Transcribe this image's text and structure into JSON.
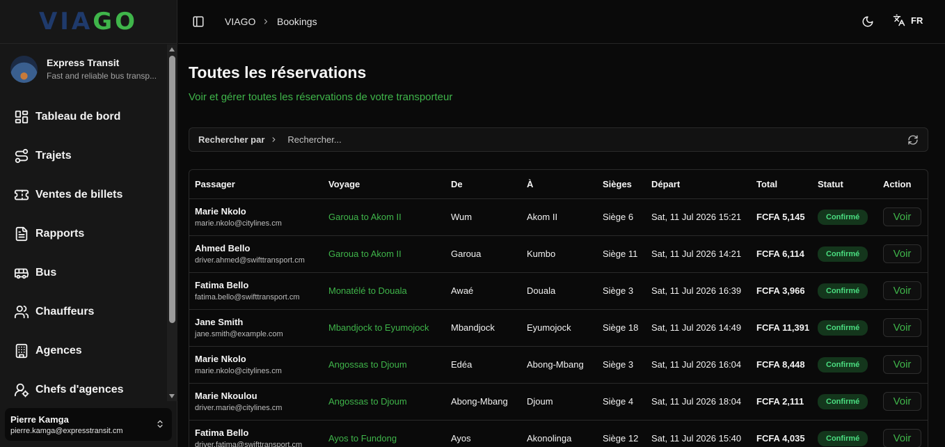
{
  "brand": {
    "logo_left": "VIA",
    "logo_right": "GO"
  },
  "company": {
    "name": "Express Transit",
    "subtitle": "Fast and reliable bus transp..."
  },
  "sidebar": {
    "items": [
      {
        "label": "Tableau de bord",
        "icon": "dashboard-icon"
      },
      {
        "label": "Trajets",
        "icon": "route-icon"
      },
      {
        "label": "Ventes de billets",
        "icon": "ticket-icon"
      },
      {
        "label": "Rapports",
        "icon": "report-icon"
      },
      {
        "label": "Bus",
        "icon": "bus-icon"
      },
      {
        "label": "Chauffeurs",
        "icon": "users-icon"
      },
      {
        "label": "Agences",
        "icon": "building-icon"
      },
      {
        "label": "Chefs d'agences",
        "icon": "user-settings-icon"
      }
    ]
  },
  "user": {
    "name": "Pierre Kamga",
    "email": "pierre.kamga@expresstransit.cm"
  },
  "topbar": {
    "crumb_root": "VIAGO",
    "crumb_current": "Bookings",
    "lang": "FR"
  },
  "page": {
    "title": "Toutes les réservations",
    "subtitle": "Voir et gérer toutes les réservations de votre transporteur"
  },
  "search": {
    "by_label": "Rechercher par",
    "placeholder": "Rechercher..."
  },
  "table": {
    "headers": [
      "Passager",
      "Voyage",
      "De",
      "À",
      "Sièges",
      "Départ",
      "Total",
      "Statut",
      "Action"
    ],
    "rows": [
      {
        "name": "Marie Nkolo",
        "email": "marie.nkolo@citylines.cm",
        "trip": "Garoua to Akom II",
        "from": "Wum",
        "to": "Akom II",
        "seat": "Siège 6",
        "departure": "Sat, 11 Jul 2026 15:21",
        "total": "FCFA 5,145",
        "status": "Confirmé",
        "action": "Voir"
      },
      {
        "name": "Ahmed Bello",
        "email": "driver.ahmed@swifttransport.cm",
        "trip": "Garoua to Akom II",
        "from": "Garoua",
        "to": "Kumbo",
        "seat": "Siège 11",
        "departure": "Sat, 11 Jul 2026 14:21",
        "total": "FCFA 6,114",
        "status": "Confirmé",
        "action": "Voir"
      },
      {
        "name": "Fatima Bello",
        "email": "fatima.bello@swifttransport.cm",
        "trip": "Monatélé to Douala",
        "from": "Awaé",
        "to": "Douala",
        "seat": "Siège 3",
        "departure": "Sat, 11 Jul 2026 16:39",
        "total": "FCFA 3,966",
        "status": "Confirmé",
        "action": "Voir"
      },
      {
        "name": "Jane Smith",
        "email": "jane.smith@example.com",
        "trip": "Mbandjock to Eyumojock",
        "from": "Mbandjock",
        "to": "Eyumojock",
        "seat": "Siège 18",
        "departure": "Sat, 11 Jul 2026 14:49",
        "total": "FCFA 11,391",
        "status": "Confirmé",
        "action": "Voir"
      },
      {
        "name": "Marie Nkolo",
        "email": "marie.nkolo@citylines.cm",
        "trip": "Angossas to Djoum",
        "from": "Edéa",
        "to": "Abong-Mbang",
        "seat": "Siège 3",
        "departure": "Sat, 11 Jul 2026 16:04",
        "total": "FCFA 8,448",
        "status": "Confirmé",
        "action": "Voir"
      },
      {
        "name": "Marie Nkoulou",
        "email": "driver.marie@citylines.cm",
        "trip": "Angossas to Djoum",
        "from": "Abong-Mbang",
        "to": "Djoum",
        "seat": "Siège 4",
        "departure": "Sat, 11 Jul 2026 18:04",
        "total": "FCFA 2,111",
        "status": "Confirmé",
        "action": "Voir"
      },
      {
        "name": "Fatima Bello",
        "email": "driver.fatima@swifttransport.cm",
        "trip": "Ayos to Fundong",
        "from": "Ayos",
        "to": "Akonolinga",
        "seat": "Siège 12",
        "departure": "Sat, 11 Jul 2026 15:40",
        "total": "FCFA 4,035",
        "status": "Confirmé",
        "action": "Voir"
      }
    ]
  },
  "colors": {
    "accent": "#3fb54a",
    "logo_dark": "#1f3a6b",
    "badge_bg": "#14361c",
    "badge_text": "#4ade80"
  }
}
